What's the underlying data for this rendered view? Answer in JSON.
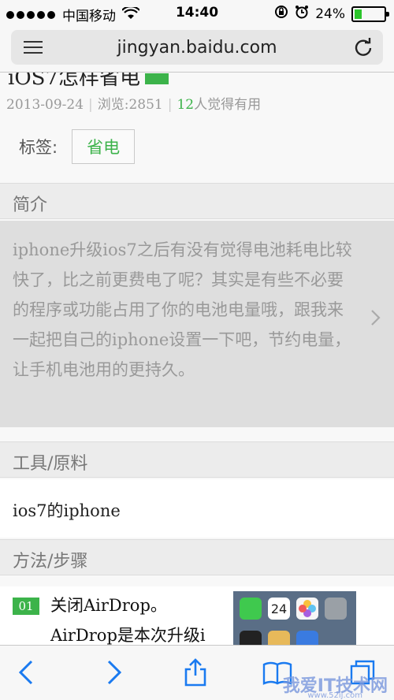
{
  "status_bar": {
    "carrier": "中国移动",
    "time": "14:40",
    "battery_percent": "24%",
    "battery_level": 0.24,
    "battery_color": "#2cc52c",
    "icons": [
      "signal-icon",
      "wifi-icon",
      "rotation-lock-icon",
      "alarm-icon",
      "battery-icon"
    ]
  },
  "url_bar": {
    "url": "jingyan.baidu.com"
  },
  "article": {
    "title_fragment": "iOS7怎样省电",
    "date": "2013-09-24",
    "views": "浏览:2851",
    "useful_count": "12",
    "useful_text": "人觉得有用",
    "tags_label": "标签:",
    "tag": "省电"
  },
  "sections": {
    "intro_header": "简介",
    "intro_text": "iphone升级ios7之后有没有觉得电池耗电比较快了，比之前更费电了呢？其实是有些不必要的程序或功能占用了你的电池电量哦，跟我来一起把自己的iphone设置一下吧，节约电量，让手机电池用的更持久。",
    "tools_header": "工具/原料",
    "tools_item": "ios7的iphone",
    "steps_header": "方法/步骤"
  },
  "steps": [
    {
      "number": "01",
      "title": "关闭AirDrop。",
      "desc": "AirDrop是本次升级i"
    }
  ],
  "thumbnail": {
    "calendar_day": "24"
  },
  "watermark": {
    "text": "我爱IT技术网",
    "sub": "www.52ij.com"
  },
  "colors": {
    "accent_green": "#3cb34a"
  }
}
